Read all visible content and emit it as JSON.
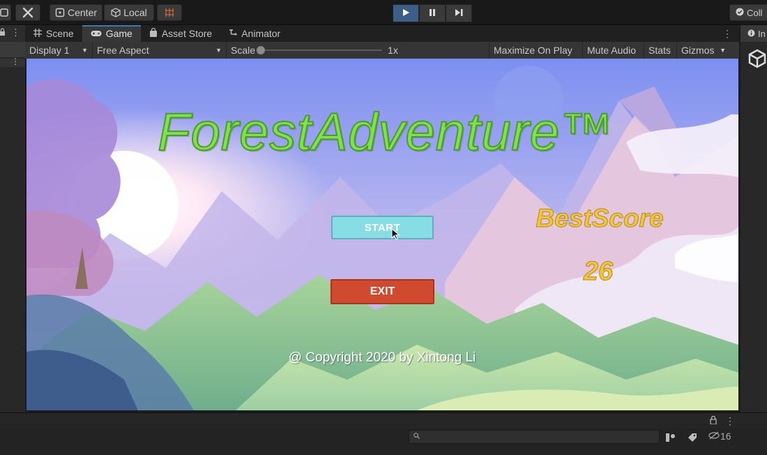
{
  "toolbar": {
    "pivot_label": "Center",
    "space_label": "Local",
    "collab_label": "Coll"
  },
  "tabs": [
    {
      "label": "Scene",
      "icon": "grid-icon"
    },
    {
      "label": "Game",
      "icon": "gamepad-icon",
      "active": true
    },
    {
      "label": "Asset Store",
      "icon": "shopping-bag-icon"
    },
    {
      "label": "Animator",
      "icon": "animator-icon"
    }
  ],
  "inspector_tab_label": "In",
  "gamebar": {
    "display": "Display 1",
    "aspect": "Free Aspect",
    "scale_label": "Scale",
    "scale_value": "1x",
    "maximize": "Maximize On Play",
    "mute": "Mute Audio",
    "stats": "Stats",
    "gizmos": "Gizmos"
  },
  "game": {
    "title": "ForestAdventure™",
    "start_button": "START",
    "exit_button": "EXIT",
    "best_score_label": "BestScore",
    "best_score_value": "26",
    "copyright": "@ Copyright 2020 by Xintong Li"
  },
  "bottom": {
    "hidden_count": "16"
  },
  "colors": {
    "accent": "#3a79bb",
    "title_green": "#7de24d",
    "start_cyan": "#86dde4",
    "exit_red": "#cf4a2e",
    "score_gold": "#f2c63a"
  }
}
